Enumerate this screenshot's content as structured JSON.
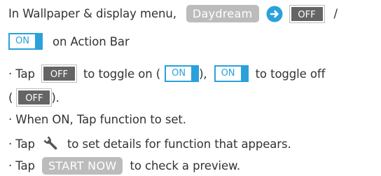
{
  "intro": {
    "text_before": "In Wallpaper & display menu,",
    "daydream_label": "Daydream",
    "slash": "/",
    "text_after": "on Action Bar"
  },
  "switch": {
    "off_label": "OFF",
    "on_label": "ON"
  },
  "bullets": {
    "b1_part1": "· Tap",
    "b1_part2": "to toggle on (",
    "b1_part3": "),",
    "b1_part4": "to toggle off",
    "b1_part5": "(",
    "b1_part6": ").",
    "b2": "· When ON, Tap function to set.",
    "b3_part1": "· Tap",
    "b3_part2": "to set details for function that appears.",
    "b4_part1": "· Tap",
    "b4_button": "START NOW",
    "b4_part2": "to check a preview."
  },
  "colors": {
    "accent": "#2aa1da",
    "off_chip": "#656565",
    "pill": "#bcbcbc",
    "text": "#333333"
  },
  "icons": {
    "arrow": "arrow-right-circle-icon",
    "wrench": "wrench-icon"
  }
}
